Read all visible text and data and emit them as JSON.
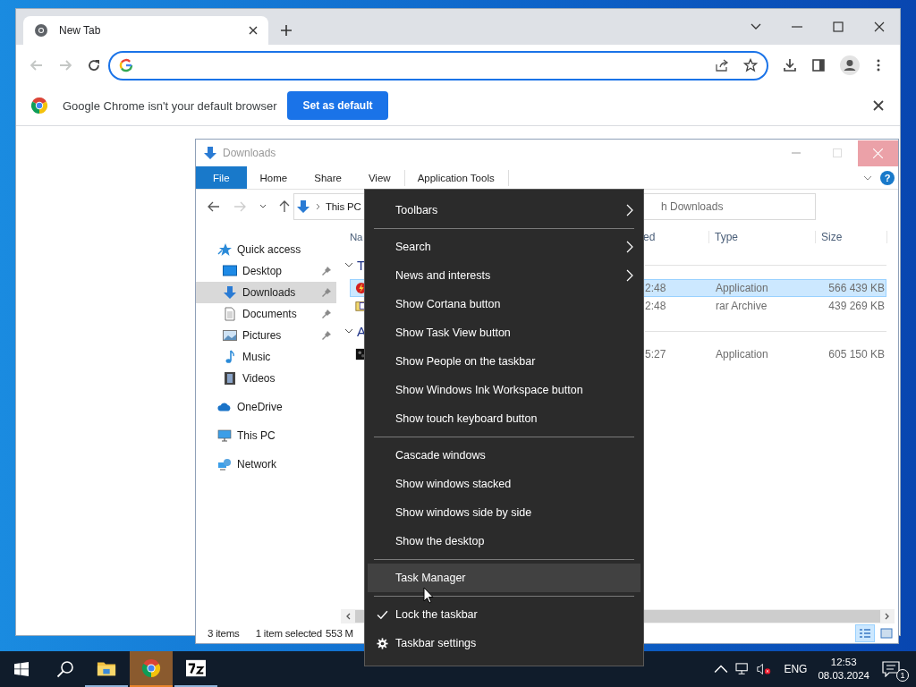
{
  "chrome": {
    "tab": {
      "title": "New Tab",
      "selected": true
    },
    "nav": {
      "back_disabled": true,
      "forward_disabled": true
    },
    "omnibox": {
      "focused": true
    },
    "infobar": {
      "message": "Google Chrome isn't your default browser",
      "button": "Set as default"
    }
  },
  "explorer": {
    "title": "Downloads",
    "active": false,
    "ribbon_tabs": [
      {
        "label": "File",
        "selected": true
      },
      {
        "label": "Home",
        "selected": false
      },
      {
        "label": "Share",
        "selected": false
      },
      {
        "label": "View",
        "selected": false
      },
      {
        "label": "Application Tools",
        "selected": false
      }
    ],
    "help": "?",
    "breadcrumb": "This PC",
    "search": {
      "placeholder": "h Downloads"
    },
    "nav": [
      {
        "label": "Quick access",
        "selected": false,
        "children": [
          {
            "label": "Desktop",
            "pinned": true,
            "selected": false
          },
          {
            "label": "Downloads",
            "pinned": true,
            "selected": true
          },
          {
            "label": "Documents",
            "pinned": true,
            "selected": false
          },
          {
            "label": "Pictures",
            "pinned": true,
            "selected": false
          },
          {
            "label": "Music",
            "pinned": false,
            "selected": false
          },
          {
            "label": "Videos",
            "pinned": false,
            "selected": false
          }
        ]
      },
      {
        "label": "OneDrive",
        "selected": false
      },
      {
        "label": "This PC",
        "selected": false
      },
      {
        "label": "Network",
        "selected": false
      }
    ],
    "columns": [
      "Na",
      "ed",
      "Type",
      "Size"
    ],
    "groups": [
      {
        "label": "T",
        "expanded": true,
        "rows": [
          {
            "cells": [
              "2:48",
              "Application",
              "566 439 KB"
            ],
            "selected": true
          },
          {
            "cells": [
              "2:48",
              "rar Archive",
              "439 269 KB"
            ],
            "selected": false
          }
        ]
      },
      {
        "label": "A",
        "expanded": true,
        "rows": [
          {
            "cells": [
              "5:27",
              "Application",
              "605 150 KB"
            ],
            "selected": false
          }
        ]
      }
    ],
    "status": {
      "count": "3 items",
      "selection": "1 item selected",
      "size": "553 M"
    },
    "views": [
      {
        "selected": true
      },
      {
        "selected": false
      }
    ]
  },
  "context_menu": {
    "sections": [
      {
        "items": [
          {
            "label": "Toolbars",
            "kind": "submenu",
            "selected": false
          }
        ]
      },
      {
        "items": [
          {
            "label": "Search",
            "kind": "submenu",
            "selected": false
          },
          {
            "label": "News and interests",
            "kind": "submenu",
            "selected": false
          },
          {
            "label": "Show Cortana button",
            "kind": "action",
            "selected": false
          },
          {
            "label": "Show Task View button",
            "kind": "action",
            "selected": false
          },
          {
            "label": "Show People on the taskbar",
            "kind": "action",
            "selected": false
          },
          {
            "label": "Show Windows Ink Workspace button",
            "kind": "action",
            "selected": false
          },
          {
            "label": "Show touch keyboard button",
            "kind": "action",
            "selected": false
          }
        ]
      },
      {
        "items": [
          {
            "label": "Cascade windows",
            "kind": "action",
            "selected": false
          },
          {
            "label": "Show windows stacked",
            "kind": "action",
            "selected": false
          },
          {
            "label": "Show windows side by side",
            "kind": "action",
            "selected": false
          },
          {
            "label": "Show the desktop",
            "kind": "action",
            "selected": false
          }
        ]
      },
      {
        "items": [
          {
            "label": "Task Manager",
            "kind": "action",
            "selected": true
          }
        ]
      },
      {
        "items": [
          {
            "label": "Lock the taskbar",
            "kind": "toggle",
            "checked": true,
            "selected": false
          },
          {
            "label": "Taskbar settings",
            "kind": "settings",
            "selected": false
          }
        ]
      }
    ]
  },
  "taskbar": {
    "apps": [
      {
        "running": true,
        "selected": false
      },
      {
        "running": false,
        "selected": true
      },
      {
        "running": true,
        "selected": false
      }
    ],
    "language": "ENG",
    "time": "12:53",
    "date": "08.03.2024",
    "notifications": "1"
  }
}
